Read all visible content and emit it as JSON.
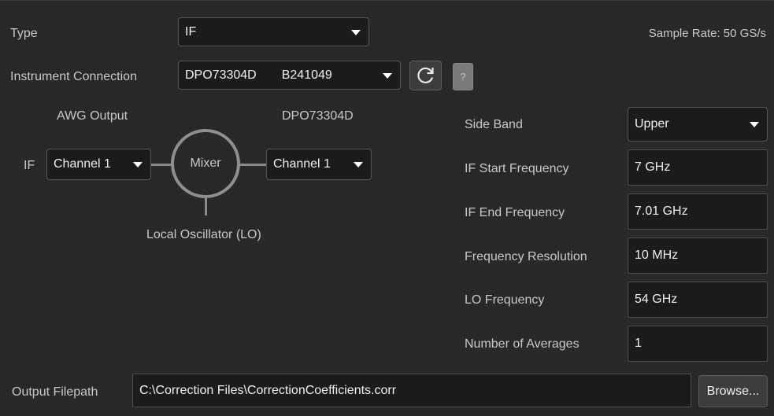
{
  "type_row": {
    "label": "Type",
    "selected": "IF",
    "sample_rate": "Sample Rate:  50 GS/s"
  },
  "instrument": {
    "label": "Instrument Connection",
    "model": "DPO73304D",
    "serial": "B241049",
    "help_label": "?"
  },
  "diagram": {
    "awg_label": "AWG Output",
    "scope_label": "DPO73304D",
    "if_label": "IF",
    "awg_channel": "Channel 1",
    "scope_channel": "Channel 1",
    "mixer_label": "Mixer",
    "lo_label": "Local Oscillator (LO)"
  },
  "settings": {
    "side_band": {
      "label": "Side Band",
      "value": "Upper"
    },
    "if_start": {
      "label": "IF Start Frequency",
      "value": "7 GHz"
    },
    "if_end": {
      "label": "IF End Frequency",
      "value": "7.01 GHz"
    },
    "freq_res": {
      "label": "Frequency Resolution",
      "value": "10 MHz"
    },
    "lo_freq": {
      "label": "LO Frequency",
      "value": "54 GHz"
    },
    "averages": {
      "label": "Number of Averages",
      "value": "1"
    }
  },
  "output": {
    "label": "Output Filepath",
    "path": "C:\\Correction Files\\CorrectionCoefficients.corr",
    "browse_label": "Browse..."
  },
  "icons": [
    "refresh-icon",
    "chevron-down-icon"
  ]
}
